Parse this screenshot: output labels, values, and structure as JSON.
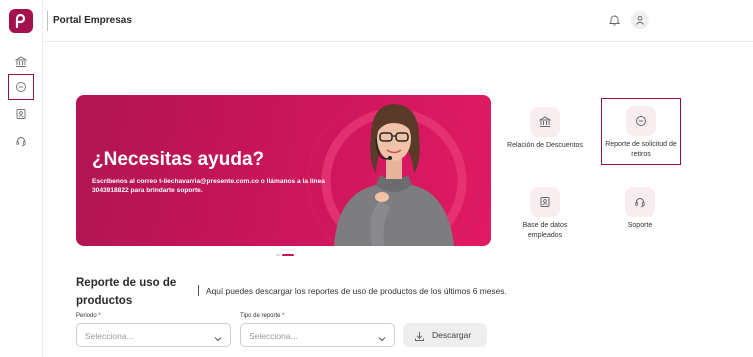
{
  "header": {
    "title": "Portal Empresas"
  },
  "banner": {
    "title": "¿Necesitas ayuda?",
    "text": "Escríbenos al correo t-ilechavarria@presente.com.co o llámanos a la línea 3043918822 para brindarte soporte."
  },
  "tiles": [
    {
      "label": "Relación de Descuentos",
      "icon": "bank-icon"
    },
    {
      "label": "Reporte de solicitud de retiros",
      "icon": "minus-circle-icon"
    },
    {
      "label": "Base de datos empleados",
      "icon": "employee-badge-icon"
    },
    {
      "label": "Soporte",
      "icon": "headset-icon"
    }
  ],
  "report": {
    "title": "Reporte de uso de productos",
    "description": "Aquí puedes descargar los reportes de uso de productos de los últimos 6 meses.",
    "period": {
      "label": "Periodo",
      "required_mark": "*",
      "placeholder": "Selecciona..."
    },
    "report_type": {
      "label": "Tipo de reporte",
      "required_mark": "*",
      "placeholder": "Selecciona..."
    },
    "download_label": "Descargar"
  },
  "colors": {
    "brand": "#c8155a",
    "brand_dark": "#8b1340",
    "tile_bg": "#f8eef0"
  }
}
